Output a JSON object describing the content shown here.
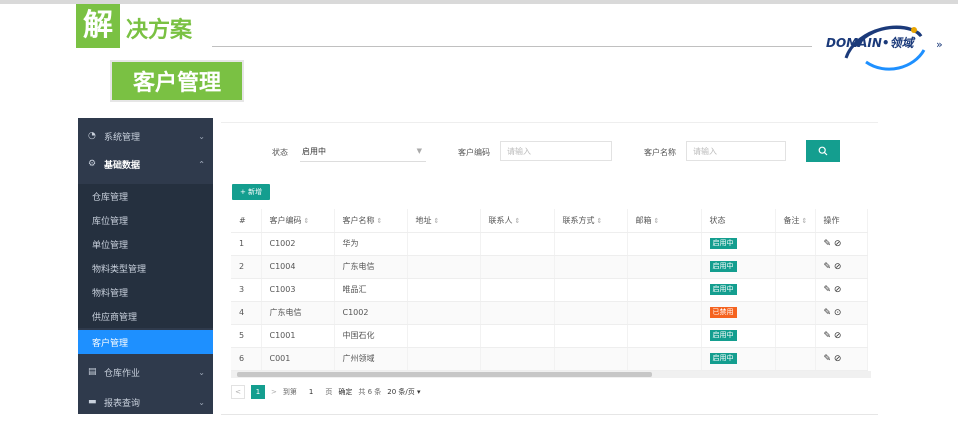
{
  "slide": {
    "title_first_char": "解",
    "title_rest": "决方案",
    "subtitle": "客户管理",
    "logo_text": "DOMAIN•领域",
    "logo_arrows": "»"
  },
  "sidebar": {
    "groups": [
      {
        "label": "系统管理",
        "icon": "gauge-icon",
        "state": "collapsed"
      },
      {
        "label": "基础数据",
        "icon": "gear-icon",
        "state": "expanded"
      },
      {
        "label": "仓库作业",
        "icon": "clipboard-icon",
        "state": "collapsed"
      },
      {
        "label": "报表查询",
        "icon": "chat-icon",
        "state": "collapsed"
      }
    ],
    "children": [
      "仓库管理",
      "库位管理",
      "单位管理",
      "物料类型管理",
      "物料管理",
      "供应商管理",
      "客户管理"
    ],
    "active_child": "客户管理"
  },
  "filters": {
    "status_label": "状态",
    "status_value": "启用中",
    "code_label": "客户编码",
    "code_placeholder": "请输入",
    "name_label": "客户名称",
    "name_placeholder": "请输入"
  },
  "toolbar": {
    "add_label": "+ 新增"
  },
  "table": {
    "headers": [
      "#",
      "客户编码",
      "客户名称",
      "地址",
      "联系人",
      "联系方式",
      "邮箱",
      "状态",
      "备注",
      "操作"
    ],
    "rows": [
      {
        "no": "1",
        "code": "C1002",
        "name": "华为",
        "status": "启用中",
        "status_kind": "on",
        "ops": "✎ ⃠"
      },
      {
        "no": "2",
        "code": "C1004",
        "name": "广东电信",
        "status": "启用中",
        "status_kind": "on",
        "ops": "✎ ⃠"
      },
      {
        "no": "3",
        "code": "C1003",
        "name": "唯品汇",
        "status": "启用中",
        "status_kind": "on",
        "ops": "✎ ⃠"
      },
      {
        "no": "4",
        "code": "广东电信",
        "name": "C1002",
        "status": "已禁用",
        "status_kind": "off",
        "ops": "✎ ✓"
      },
      {
        "no": "5",
        "code": "C1001",
        "name": "中国石化",
        "status": "启用中",
        "status_kind": "on",
        "ops": "✎ ⃠"
      },
      {
        "no": "6",
        "code": "C001",
        "name": "广州领域",
        "status": "启用中",
        "status_kind": "on",
        "ops": "✎ ⃠"
      }
    ]
  },
  "pager": {
    "prev": "<",
    "current": "1",
    "next": ">",
    "goto_label": "到第",
    "goto_value": "1",
    "page_unit": "页",
    "confirm": "确定",
    "total": "共 6 条",
    "page_size": "20 条/页 ▾"
  },
  "colors": {
    "brand_green": "#7ac143",
    "teal": "#149e8f",
    "sidebar_bg": "#2f3a4c",
    "active_blue": "#1e90ff",
    "danger": "#f5631f"
  }
}
